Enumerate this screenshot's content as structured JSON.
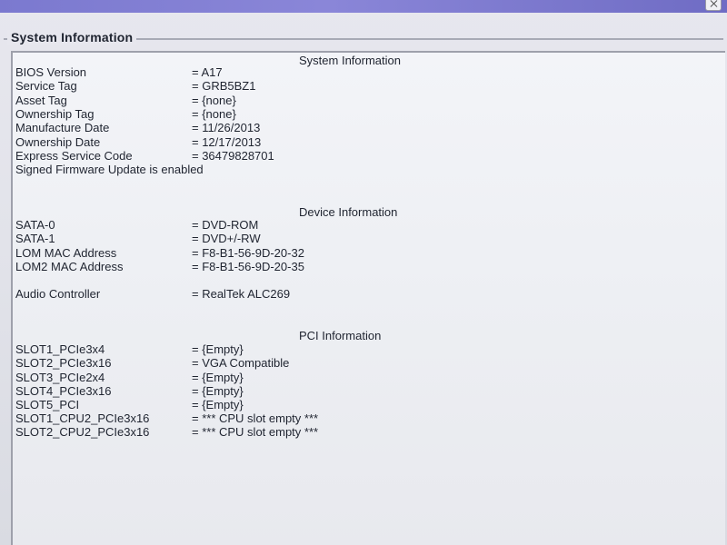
{
  "group_title": "System Information",
  "sections": {
    "system": {
      "title": "System Information",
      "rows": [
        {
          "label": "BIOS Version",
          "value": "= A17"
        },
        {
          "label": "Service Tag",
          "value": "= GRB5BZ1"
        },
        {
          "label": "Asset Tag",
          "value": "= {none}"
        },
        {
          "label": "Ownership Tag",
          "value": "= {none}"
        },
        {
          "label": "Manufacture Date",
          "value": "= 11/26/2013"
        },
        {
          "label": "Ownership Date",
          "value": "= 12/17/2013"
        },
        {
          "label": "Express Service Code",
          "value": "= 36479828701"
        }
      ],
      "note": "Signed Firmware Update is enabled"
    },
    "device": {
      "title": "Device Information",
      "rows": [
        {
          "label": "SATA-0",
          "value": "= DVD-ROM"
        },
        {
          "label": "SATA-1",
          "value": "= DVD+/-RW"
        },
        {
          "label": "LOM MAC Address",
          "value": "= F8-B1-56-9D-20-32"
        },
        {
          "label": "LOM2 MAC Address",
          "value": "= F8-B1-56-9D-20-35"
        },
        {
          "label": "Audio Controller",
          "value": "= RealTek ALC269"
        }
      ]
    },
    "pci": {
      "title": "PCI Information",
      "rows": [
        {
          "label": "SLOT1_PCIe3x4",
          "value": "= {Empty}"
        },
        {
          "label": "SLOT2_PCIe3x16",
          "value": "= VGA Compatible"
        },
        {
          "label": "SLOT3_PCIe2x4",
          "value": "= {Empty}"
        },
        {
          "label": "SLOT4_PCIe3x16",
          "value": "= {Empty}"
        },
        {
          "label": "SLOT5_PCI",
          "value": "= {Empty}"
        },
        {
          "label": "SLOT1_CPU2_PCIe3x16",
          "value": "= *** CPU slot empty ***"
        },
        {
          "label": "SLOT2_CPU2_PCIe3x16",
          "value": "= *** CPU slot empty ***"
        }
      ]
    }
  }
}
